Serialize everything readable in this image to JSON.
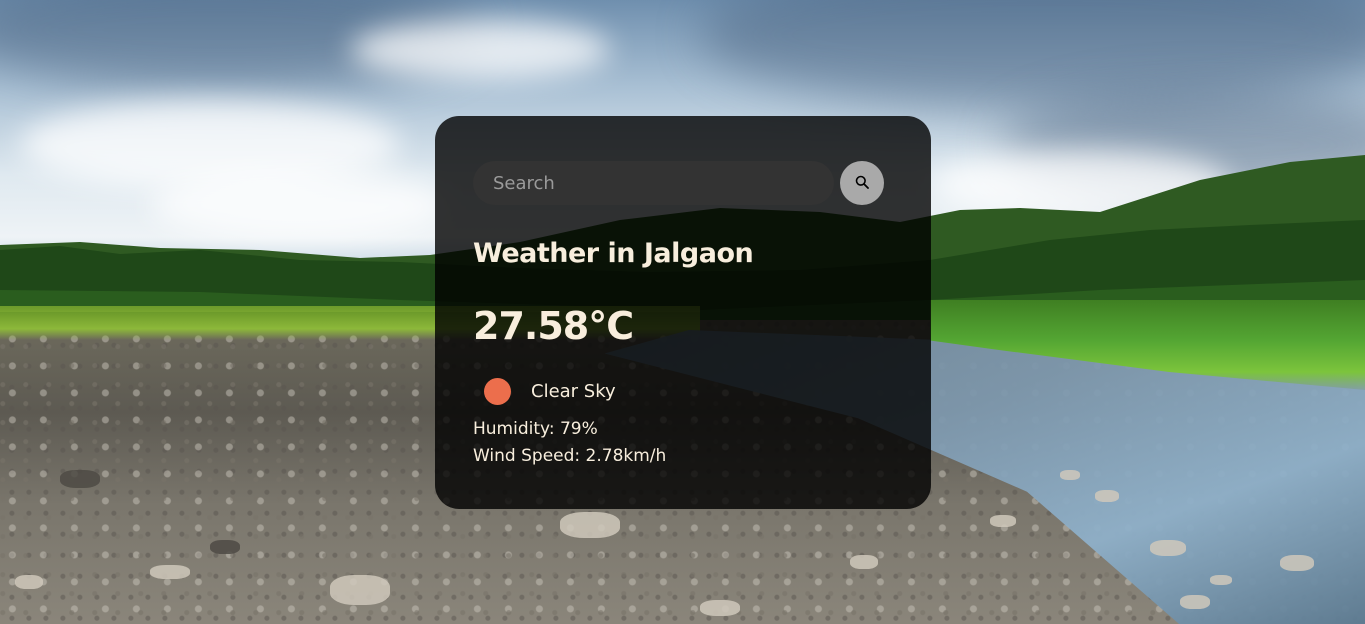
{
  "search": {
    "placeholder": "Search",
    "value": ""
  },
  "weather": {
    "title": "Weather in Jalgaon",
    "temperature": "27.58°C",
    "description": "Clear Sky",
    "humidity": "Humidity: 79%",
    "wind": "Wind Speed: 2.78km/h"
  },
  "icons": {
    "search_button": "search-icon",
    "weather": "clear-sky-icon"
  },
  "colors": {
    "card_bg": "#000000cc",
    "text": "#f8eedd",
    "search_bg": "#333333",
    "search_button_bg": "#a9a9a9",
    "weather_dot": "#ec6e4c"
  }
}
